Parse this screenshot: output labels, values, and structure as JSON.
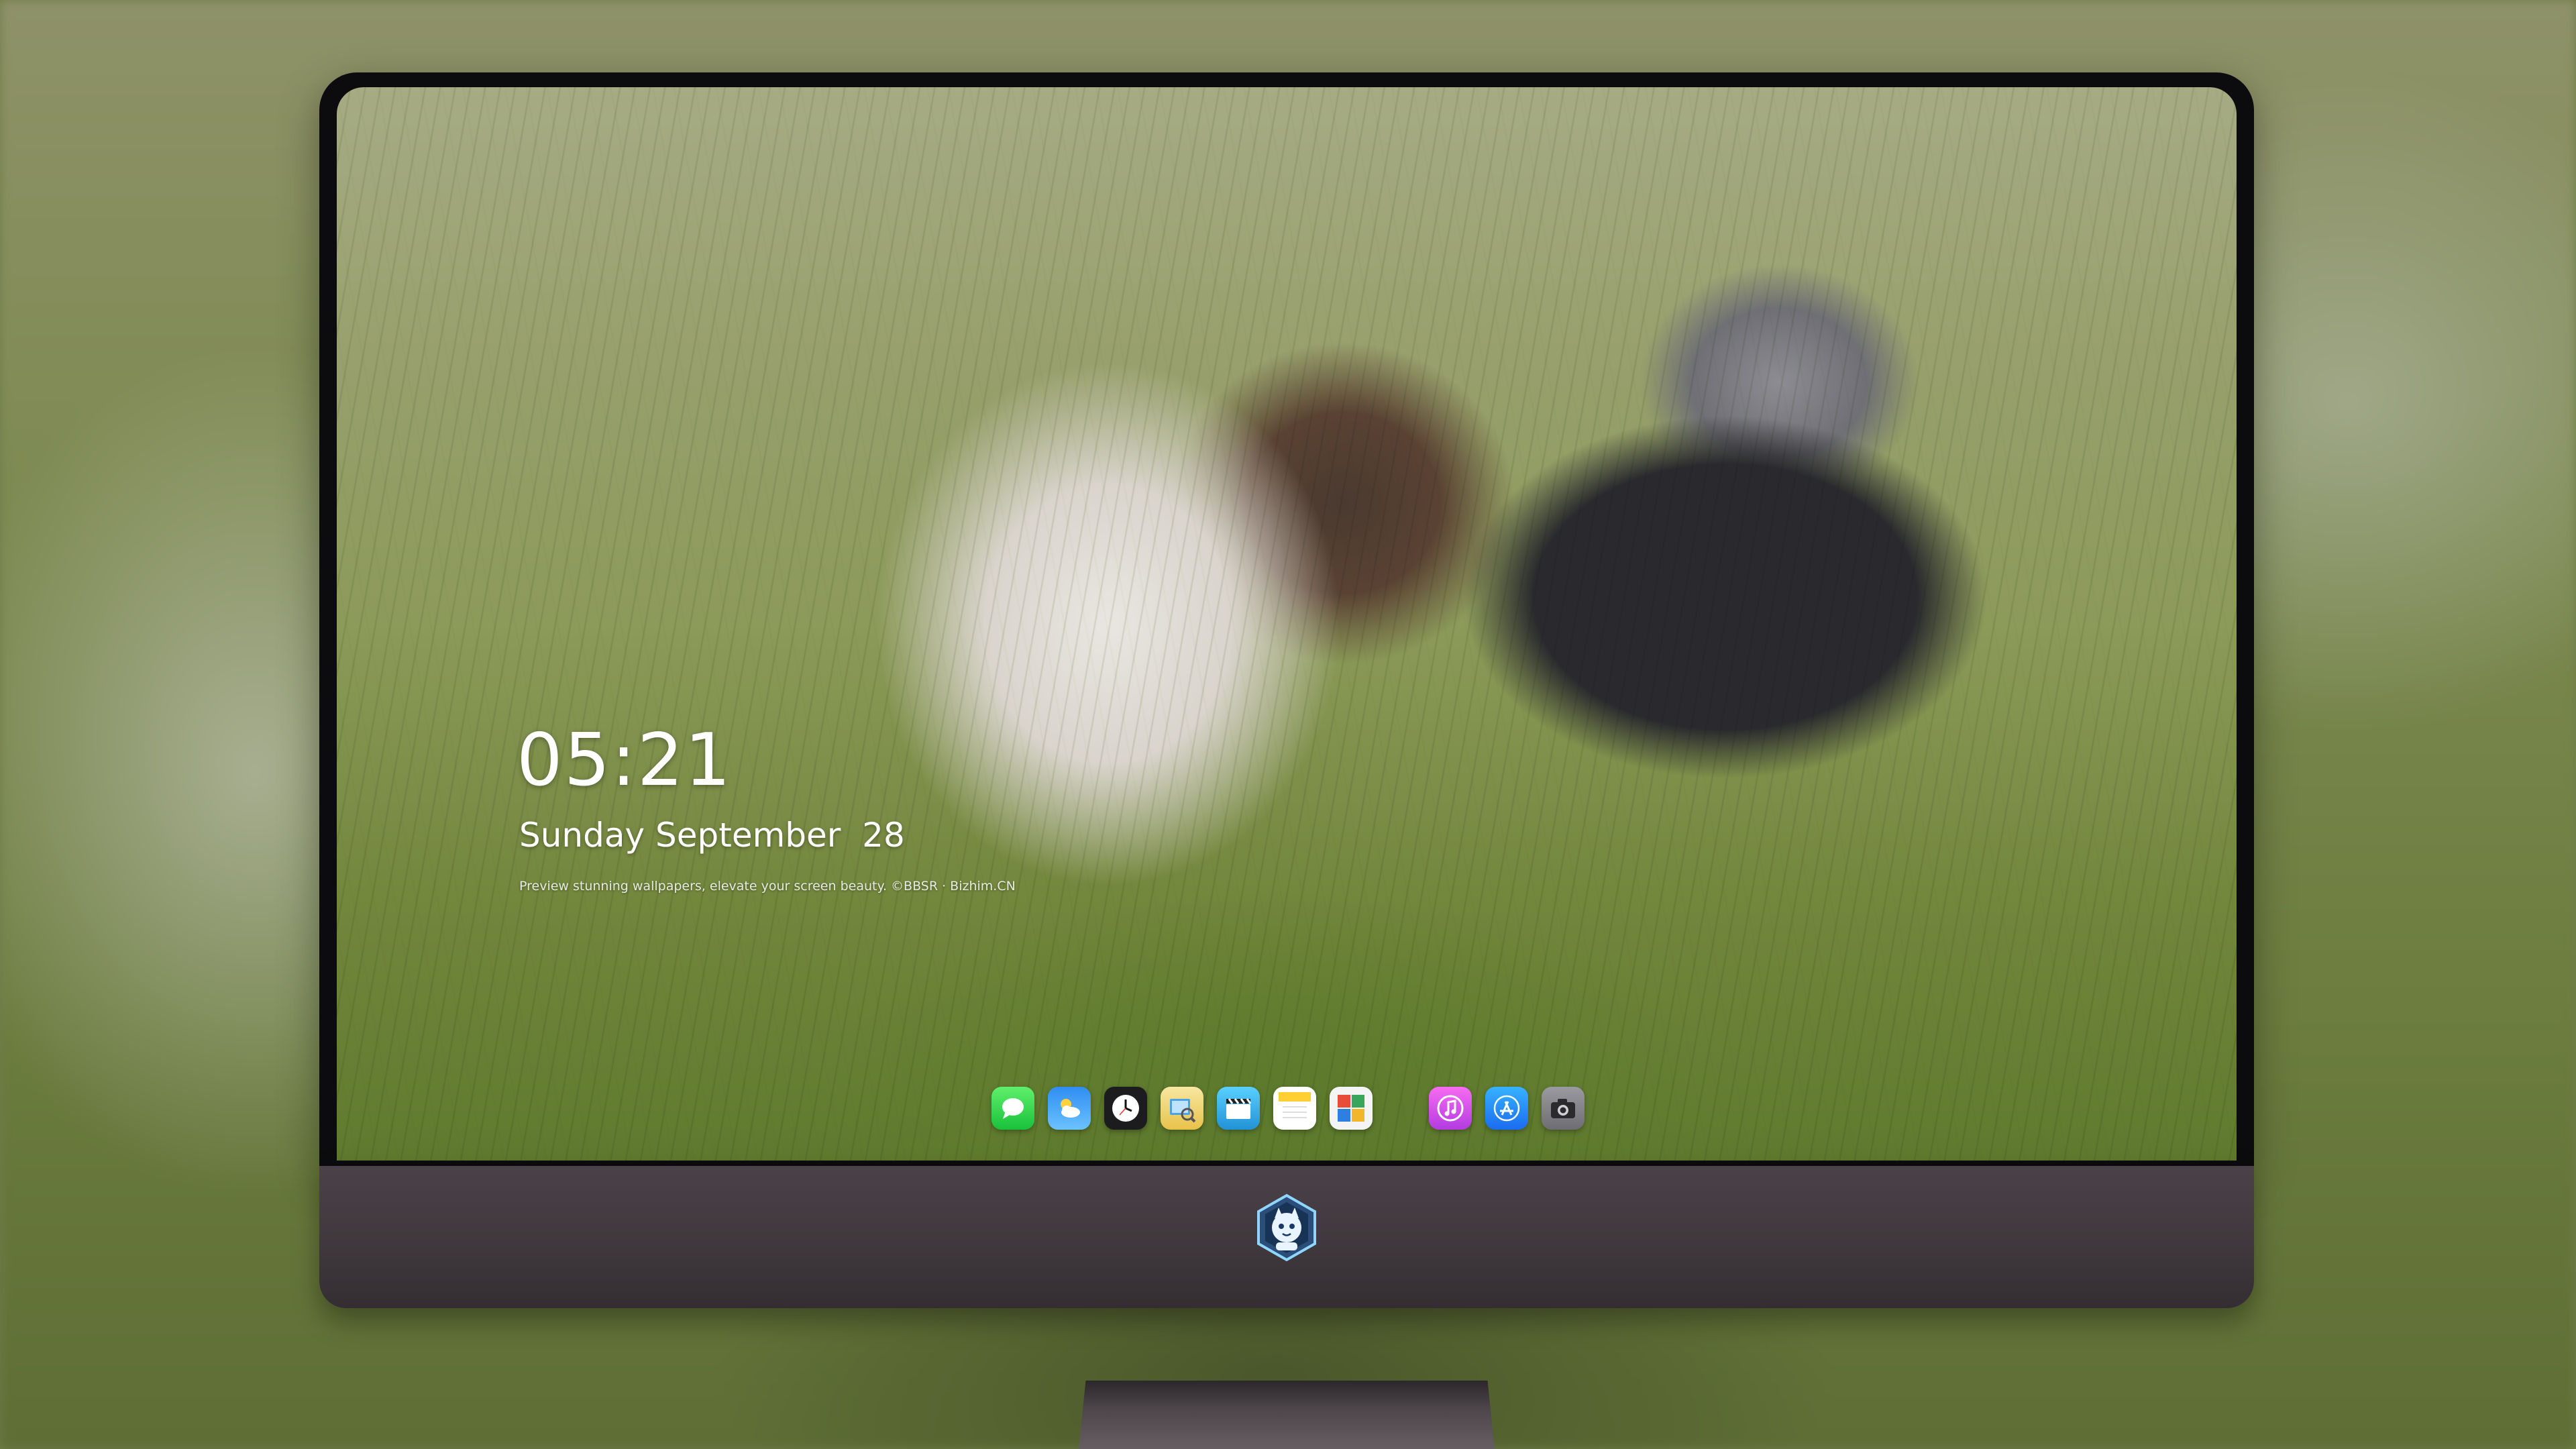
{
  "lockscreen": {
    "time": "05:21",
    "date": "Sunday September  28",
    "tagline": "Preview stunning wallpapers, elevate your screen beauty. ©BBSR · Bizhim.CN"
  },
  "dock": {
    "apps": [
      {
        "name": "messages-icon",
        "color": "#2ecc40"
      },
      {
        "name": "weather-icon",
        "color": "#3aa0ff"
      },
      {
        "name": "clock-icon",
        "color": "#1c1c1e"
      },
      {
        "name": "preview-icon",
        "color": "#f4c542"
      },
      {
        "name": "clapperboard-icon",
        "color": "#35b6e8"
      },
      {
        "name": "notes-icon",
        "color": "#ffd54a"
      },
      {
        "name": "photo-booth-icon",
        "color": "#e94d3a"
      },
      {
        "name": "music-icon",
        "color": "#e84bd8"
      },
      {
        "name": "app-store-icon",
        "color": "#2f8cff"
      },
      {
        "name": "camera-icon",
        "color": "#8e8e93"
      }
    ]
  },
  "monitor": {
    "logo": "mascot-logo-icon",
    "bezel_color": "#0c0c0e",
    "chin_color": "#3e373c"
  }
}
